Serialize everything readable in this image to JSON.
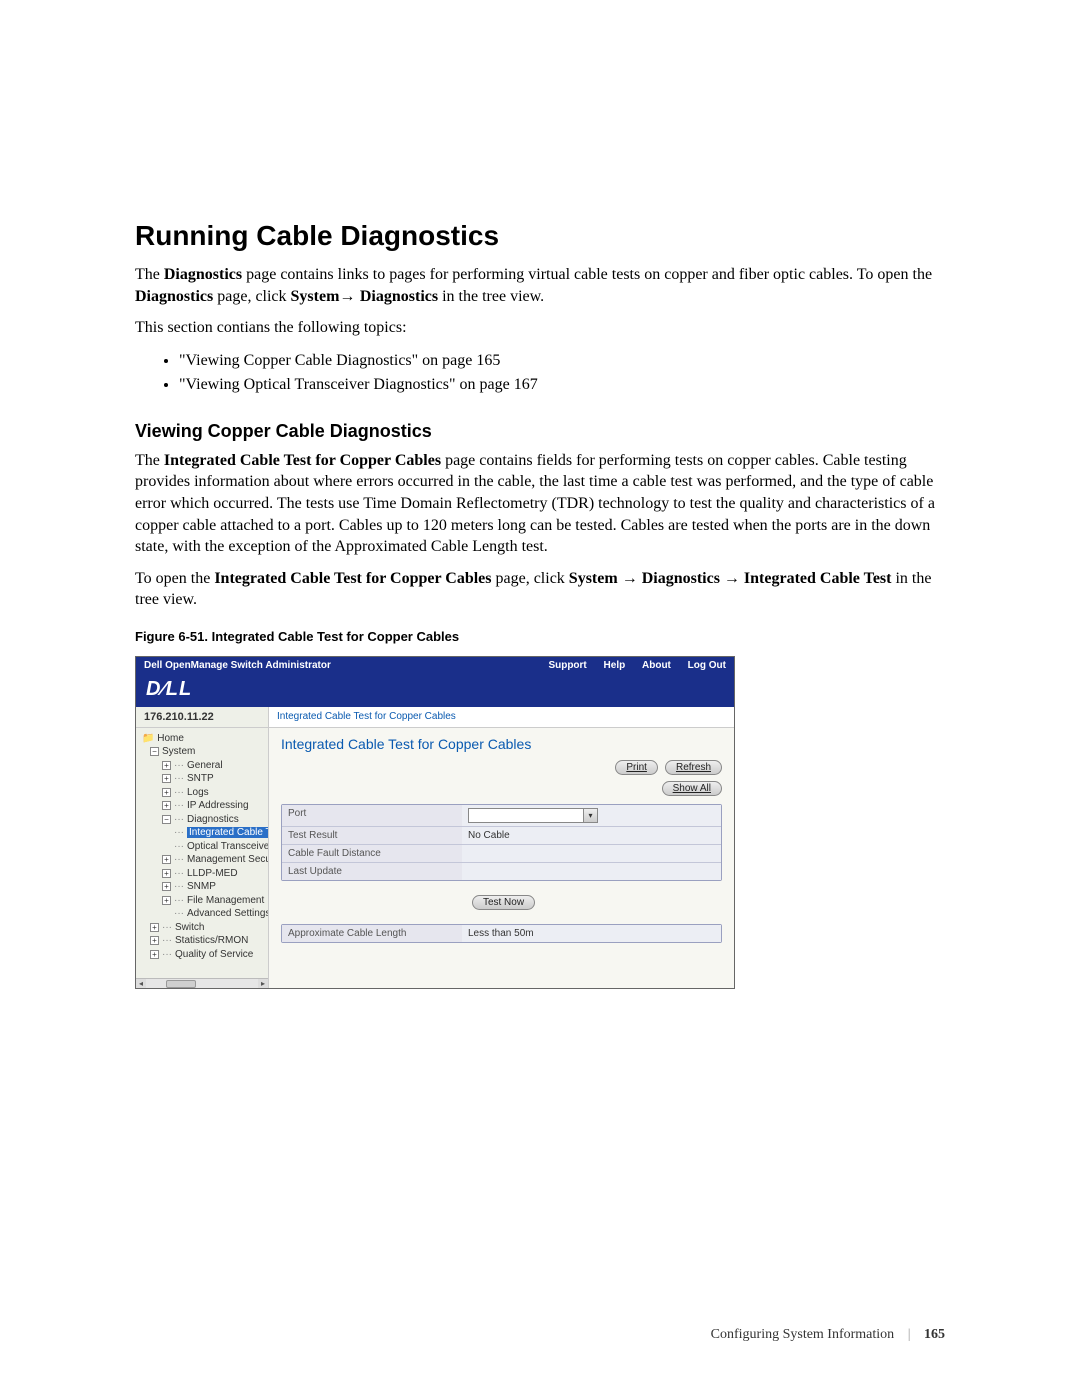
{
  "heading": "Running Cable Diagnostics",
  "intro": {
    "t1": "The ",
    "b1": "Diagnostics",
    "t2": " page contains links to pages for performing virtual cable tests on copper and fiber optic cables. To open the ",
    "b2": "Diagnostics",
    "t3": " page, click ",
    "b3": "System",
    "arrow1": "→ ",
    "b4": "Diagnostics",
    "t4": " in the tree view."
  },
  "topics_intro": "This section contians the following topics:",
  "topics": [
    "\"Viewing Copper Cable Diagnostics\" on page 165",
    "\"Viewing Optical Transceiver Diagnostics\" on page 167"
  ],
  "subheading": "Viewing Copper Cable Diagnostics",
  "para2": {
    "t1": "The ",
    "b1": "Integrated Cable Test for Copper Cables",
    "t2": " page contains fields for performing tests on copper cables. Cable testing provides information about where errors occurred in the cable, the last time a cable test was performed, and the type of cable error which occurred. The tests use Time Domain Reflectometry (TDR) technology to test the quality and characteristics of a copper cable attached to a port. Cables up to 120 meters long can be tested. Cables are tested when the ports are in the down state, with the exception of the Approximated Cable Length test."
  },
  "para3": {
    "t1": "To open the ",
    "b1": "Integrated Cable Test for Copper Cables",
    "t2": " page, click ",
    "b2": "System ",
    "arrow1": "→",
    "b3": " Diagnostics ",
    "arrow2": "→",
    "b4": " Integrated Cable Test",
    "t3": " in the tree view."
  },
  "figure_caption": "Figure 6-51.    Integrated Cable Test for Copper Cables",
  "shot": {
    "titlebar": "Dell OpenManage Switch Administrator",
    "nav": [
      "Support",
      "Help",
      "About",
      "Log Out"
    ],
    "logo": "D∕LL",
    "ip": "176.210.11.22",
    "breadcrumb": "Integrated Cable Test for Copper Cables",
    "tree": {
      "home": "Home",
      "system": "System",
      "items": [
        "General",
        "SNTP",
        "Logs",
        "IP Addressing",
        "Diagnostics"
      ],
      "diag_children": [
        "Integrated Cable T",
        "Optical Transceiver I"
      ],
      "rest": [
        "Management Security",
        "LLDP-MED",
        "SNMP",
        "File Management",
        "Advanced Settings"
      ],
      "switch": "Switch",
      "stats": "Statistics/RMON",
      "qos": "Quality of Service"
    },
    "content": {
      "title": "Integrated Cable Test for Copper Cables",
      "print": "Print",
      "refresh": "Refresh",
      "show_all": "Show All",
      "rows": {
        "port": "Port",
        "test_result_label": "Test Result",
        "test_result_value": "No Cable",
        "fault_label": "Cable Fault Distance",
        "fault_value": "",
        "update_label": "Last Update",
        "update_value": ""
      },
      "test_now": "Test Now",
      "approx_label": "Approximate Cable Length",
      "approx_value": "Less than 50m"
    }
  },
  "footer": {
    "section": "Configuring System Information",
    "page": "165"
  }
}
